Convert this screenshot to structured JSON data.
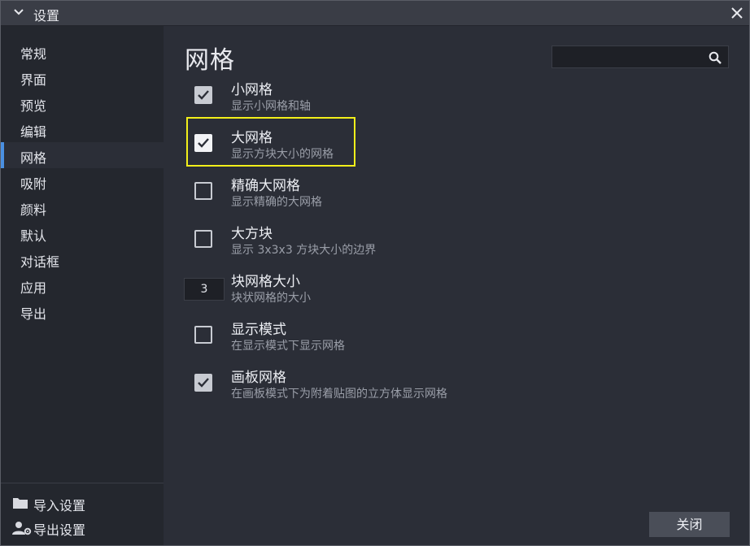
{
  "window": {
    "title": "设置"
  },
  "sidebar": {
    "items": [
      {
        "label": "常规"
      },
      {
        "label": "界面"
      },
      {
        "label": "预览"
      },
      {
        "label": "编辑"
      },
      {
        "label": "网格"
      },
      {
        "label": "吸附"
      },
      {
        "label": "颜料"
      },
      {
        "label": "默认"
      },
      {
        "label": "对话框"
      },
      {
        "label": "应用"
      },
      {
        "label": "导出"
      }
    ],
    "active": "网格",
    "actions": [
      {
        "label": "导入设置",
        "icon": "folder-icon"
      },
      {
        "label": "导出设置",
        "icon": "user-settings-icon"
      }
    ]
  },
  "main": {
    "title": "网格",
    "search": {
      "value": "",
      "placeholder": ""
    },
    "settings": [
      {
        "label": "小网格",
        "description": "显示小网格和轴",
        "type": "checkbox",
        "checked": true
      },
      {
        "label": "大网格",
        "description": "显示方块大小的网格",
        "type": "checkbox",
        "checked": true,
        "highlighted": true
      },
      {
        "label": "精确大网格",
        "description": "显示精确的大网格",
        "type": "checkbox",
        "checked": false
      },
      {
        "label": "大方块",
        "description": "显示 3x3x3 方块大小的边界",
        "type": "checkbox",
        "checked": false
      },
      {
        "label": "块网格大小",
        "description": "块状网格的大小",
        "type": "number",
        "value": "3"
      },
      {
        "label": "显示模式",
        "description": "在显示模式下显示网格",
        "type": "checkbox",
        "checked": false
      },
      {
        "label": "画板网格",
        "description": "在画板模式下为附着贴图的立方体显示网格",
        "type": "checkbox",
        "checked": true
      }
    ]
  },
  "footer": {
    "close_label": "关闭"
  },
  "colors": {
    "background": "#2b2e37",
    "sidebar": "#24272e",
    "accent": "#4a90e2",
    "highlight": "#f2ef1a"
  }
}
